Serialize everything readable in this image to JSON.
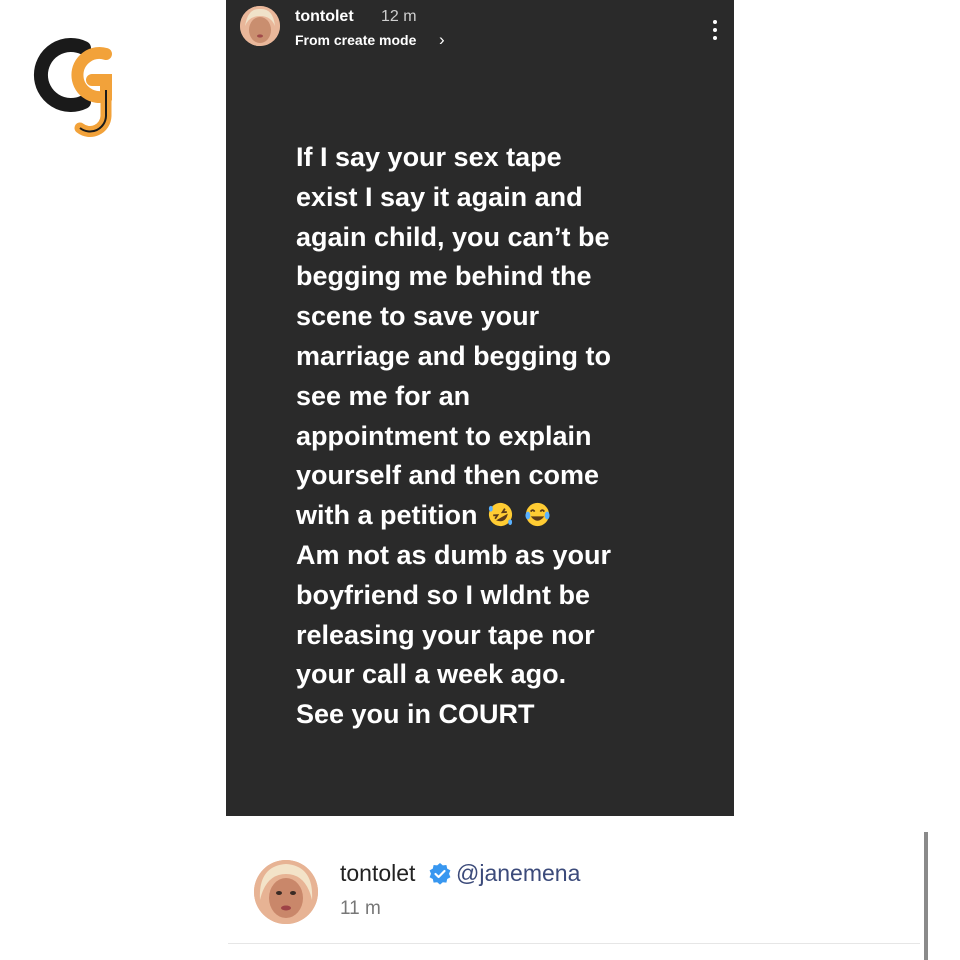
{
  "watermark": {
    "name": "cg-logo-icon",
    "colors": {
      "dark": "#1a1a1a",
      "accent": "#f2a23a"
    }
  },
  "story": {
    "username": "tontolet",
    "time": "12 m",
    "mode_label": "From create mode",
    "chevron": "›",
    "more_icon": "more-vertical-icon",
    "lines": [
      "If I say your sex tape",
      "exist I say it again and",
      "again child, you can’t be",
      "begging me behind the",
      "scene to save your",
      "marriage and begging to",
      "see me for an",
      "appointment to explain",
      "yourself and then come",
      "with a petition",
      "Am not as dumb as your",
      "boyfriend so I wldnt be",
      "releasing your tape nor",
      "your call a week ago.",
      "See you in COURT"
    ],
    "emojis": [
      "rolling-on-floor-laughing-icon",
      "tears-of-joy-icon"
    ],
    "background": "#2a2a2a"
  },
  "comment": {
    "username": "tontolet",
    "verified_icon": "verified-badge-icon",
    "mention": "@janemena",
    "time": "11 m",
    "accent": "#3897f0"
  }
}
